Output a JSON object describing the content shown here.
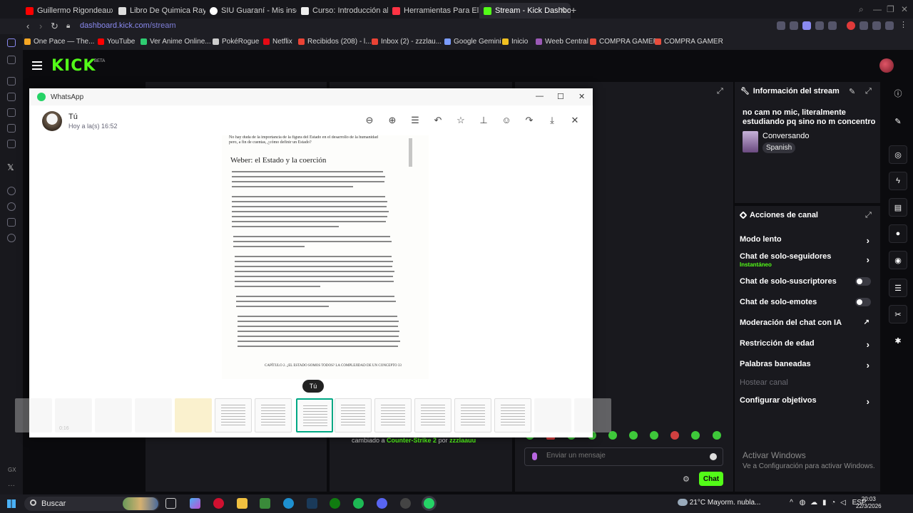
{
  "browser": {
    "tabs": [
      {
        "label": "Guillermo Rigondeaux Vs",
        "color": "#ff0000"
      },
      {
        "label": "Libro De Quimica Raymon",
        "color": "#dddddd"
      },
      {
        "label": "SIU Guaraní - Mis inscripc",
        "color": "#ffffff"
      },
      {
        "label": "Curso: Introducción al Co",
        "color": "#eeeeee"
      },
      {
        "label": "Herramientas Para El Anál",
        "color": "#ff3344"
      },
      {
        "label": "Stream - Kick Dashboa",
        "color": "#53fc18"
      }
    ],
    "url_domain": "dashboard.kick.com",
    "url_path": "/stream",
    "bookmarks": [
      {
        "label": "One Pace — The...",
        "color": "#f5a623"
      },
      {
        "label": "YouTube",
        "color": "#ff0000"
      },
      {
        "label": "Ver Anime Online...",
        "color": "#2ecc71"
      },
      {
        "label": "PokéRogue",
        "color": "#cccccc"
      },
      {
        "label": "Netflix",
        "color": "#e50914"
      },
      {
        "label": "Recibidos (208) - l...",
        "color": "#ea4335"
      },
      {
        "label": "Inbox (2) - zzzlau...",
        "color": "#ea4335"
      },
      {
        "label": "Google Gemini",
        "color": "#7b9cff"
      },
      {
        "label": "Inicio",
        "color": "#f0c020"
      },
      {
        "label": "Weeb Central",
        "color": "#9b59b6"
      },
      {
        "label": "COMPRA GAMER",
        "color": "#e74c3c"
      },
      {
        "label": "COMPRA GAMER",
        "color": "#e74c3c"
      }
    ]
  },
  "kick": {
    "logo": "KICK",
    "beta": "BETA",
    "stream_info": {
      "title": "Información del stream",
      "stream_title": "no cam no mic, literalmente estudiando pq sino no m concentro",
      "category": "Conversando",
      "language": "Spanish"
    },
    "channel_actions": {
      "title": "Acciones de canal",
      "items": [
        {
          "label": "Modo lento",
          "control": "chevron"
        },
        {
          "label": "Chat de solo-seguidores",
          "sub": "Instantáneo",
          "control": "chevron"
        },
        {
          "label": "Chat de solo-suscriptores",
          "control": "toggle"
        },
        {
          "label": "Chat de solo-emotes",
          "control": "toggle"
        },
        {
          "label": "Moderación del chat con IA",
          "control": "external"
        },
        {
          "label": "Restricción de edad",
          "control": "chevron"
        },
        {
          "label": "Palabras baneadas",
          "control": "chevron"
        },
        {
          "label": "Hostear canal",
          "control": "none",
          "disabled": true
        },
        {
          "label": "Configurar objetivos",
          "control": "chevron"
        }
      ]
    },
    "chat": {
      "event_prefix": "cambiado a",
      "event_game": "Counter-Strike 2",
      "event_by": "por",
      "event_user": "zzzlaauu",
      "placeholder": "Enviar un mensaje",
      "send_label": "Chat"
    }
  },
  "whatsapp": {
    "window_title": "WhatsApp",
    "sender": "Tú",
    "timestamp": "Hoy a la(s) 16:52",
    "tag": "Tú",
    "thumb_label": "0:16",
    "document": {
      "intro": "No hay duda de la importancia de la figura del Estado en el desarrollo de la humanidad pero, a fin de cuentas, ¿cómo definir un Estado?",
      "heading": "Weber: el Estado y la coerción",
      "footer": "CAPÍTULO 2. ¿EL ESTADO SOMOS TODOS? LA COMPLEJIDAD DE UN CONCEPTO   33"
    }
  },
  "windows": {
    "activate_title": "Activar Windows",
    "activate_sub": "Ve a Configuración para activar Windows.",
    "search": "Buscar",
    "weather": "21°C  Mayorm. nubla...",
    "lang": "ESP",
    "time": "20:03",
    "date": "22/3/2026"
  },
  "colors": {
    "kick_green": "#53fc18",
    "whatsapp_green": "#25d366"
  }
}
